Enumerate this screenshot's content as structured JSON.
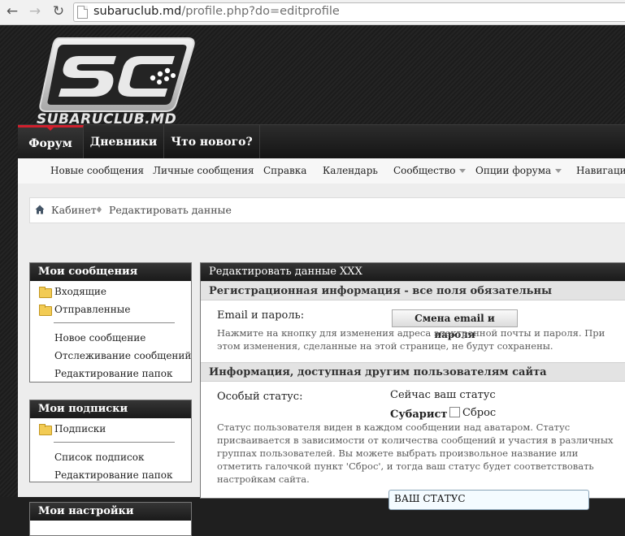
{
  "browser": {
    "url_host": "subaruclub.md",
    "url_path": "/profile.php?do=editprofile"
  },
  "logo": {
    "text": "SUBARUCLUB.MD",
    "monogram": "SC"
  },
  "main_nav": {
    "tabs": [
      "Форум",
      "Дневники",
      "Что нового?"
    ],
    "active": "Форум"
  },
  "sub_nav": {
    "items": [
      "Новые сообщения",
      "Личные сообщения",
      "Справка",
      "Календарь",
      "Сообщество",
      "Опции форума",
      "Навигаци"
    ]
  },
  "breadcrumb": {
    "items": [
      "Кабинет",
      "Редактировать данные"
    ]
  },
  "sidebar": {
    "messages": {
      "title": "Мои сообщения",
      "folders": [
        "Входящие",
        "Отправленные"
      ],
      "links": [
        "Новое сообщение",
        "Отслеживание сообщений",
        "Редактирование папок"
      ]
    },
    "subscriptions": {
      "title": "Мои подписки",
      "folders": [
        "Подписки"
      ],
      "links": [
        "Список подписок",
        "Редактирование папок"
      ]
    },
    "settings": {
      "title": "Мои настройки"
    }
  },
  "panel": {
    "title": "Редактировать данные XXX",
    "registration": {
      "heading": "Регистрационная информация - все поля обязательны",
      "label": "Email и пароль:",
      "button": "Смена email и пароля",
      "description": "Нажмите на кнопку для изменения адреса электронной почты и пароля. При этом изменения, сделанные на этой странице, не будут сохранены."
    },
    "public_info": {
      "heading": "Информация, доступная другим пользователям сайта",
      "status_label": "Особый статус:",
      "current_label": "Сейчас ваш статус",
      "current_value": "Субарист",
      "reset_label": "Сброс",
      "reset_checked": false,
      "description": "Статус пользователя виден в каждом сообщении над аватаром. Статус присваивается в зависимости от количества сообщений и участия в различных группах пользователей. Вы можете выбрать произвольное название или отметить галочкой пункт 'Сброс', и тогда ваш статус будет соответствовать настройкам сайта.",
      "input_value": "ВАШ СТАТУС"
    }
  },
  "colors": {
    "accent": "#d0202d",
    "header_dark": "#1a1a1a",
    "input_border": "#8aa4b8"
  }
}
